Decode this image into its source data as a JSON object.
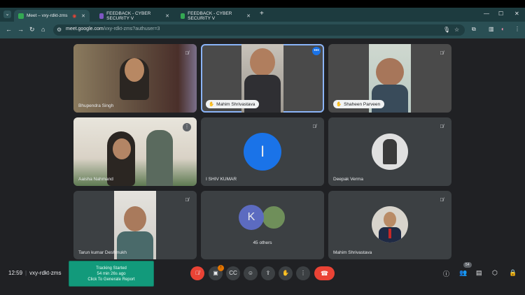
{
  "browser": {
    "tabs": [
      {
        "label": "Meet – vxy-rdkt-zms",
        "favicon_color": "#34a853"
      },
      {
        "label": "FEEDBACK - CYBER SECURITY V",
        "favicon_color": "#7e57c2"
      },
      {
        "label": "FEEDBACK - CYBER SECURITY V",
        "favicon_color": "#34a853"
      }
    ],
    "url_host": "meet.google.com",
    "url_path": "/vxy-rdkt-zms?authuser=3"
  },
  "tiles": [
    {
      "name": "Bhupendra Singh",
      "mic": "muted"
    },
    {
      "name": "Mahim Shrivastava",
      "mic": "speaking"
    },
    {
      "name": "Shaheen Parveen",
      "mic": "muted"
    },
    {
      "name": "Aaisha Nahmand",
      "mic": "idle"
    },
    {
      "name": "I SHIV KUMAR",
      "avatar_letter": "I",
      "avatar_color": "#1a73e8",
      "mic": "muted"
    },
    {
      "name": "Deepak Verma",
      "mic": "muted"
    },
    {
      "name": "Tarun kumar Deshmukh",
      "mic": "muted"
    },
    {
      "name": "45 others",
      "avatar_letter": "K",
      "avatar_color": "#5c6bc0"
    },
    {
      "name": "Mahim Shrivastava",
      "mic": "muted"
    }
  ],
  "meeting": {
    "time": "12:59",
    "code": "vxy-rdkt-zms",
    "participant_count": "54"
  },
  "tracker": {
    "line1": "Tracking Started",
    "line2": "54 min 26s ago",
    "line3": "Click To Generate Report"
  },
  "icons": [
    "menu-icon",
    "close-icon",
    "new-tab-icon",
    "minimize-icon",
    "maximize-icon",
    "back-icon",
    "forward-icon",
    "reload-icon",
    "home-icon",
    "mic-off-icon",
    "camera-icon",
    "captions-icon",
    "emoji-icon",
    "present-icon",
    "raise-hand-icon",
    "more-icon",
    "end-call-icon",
    "info-icon",
    "people-icon",
    "chat-icon",
    "activities-icon",
    "lock-icon",
    "bookmark-star-icon"
  ]
}
